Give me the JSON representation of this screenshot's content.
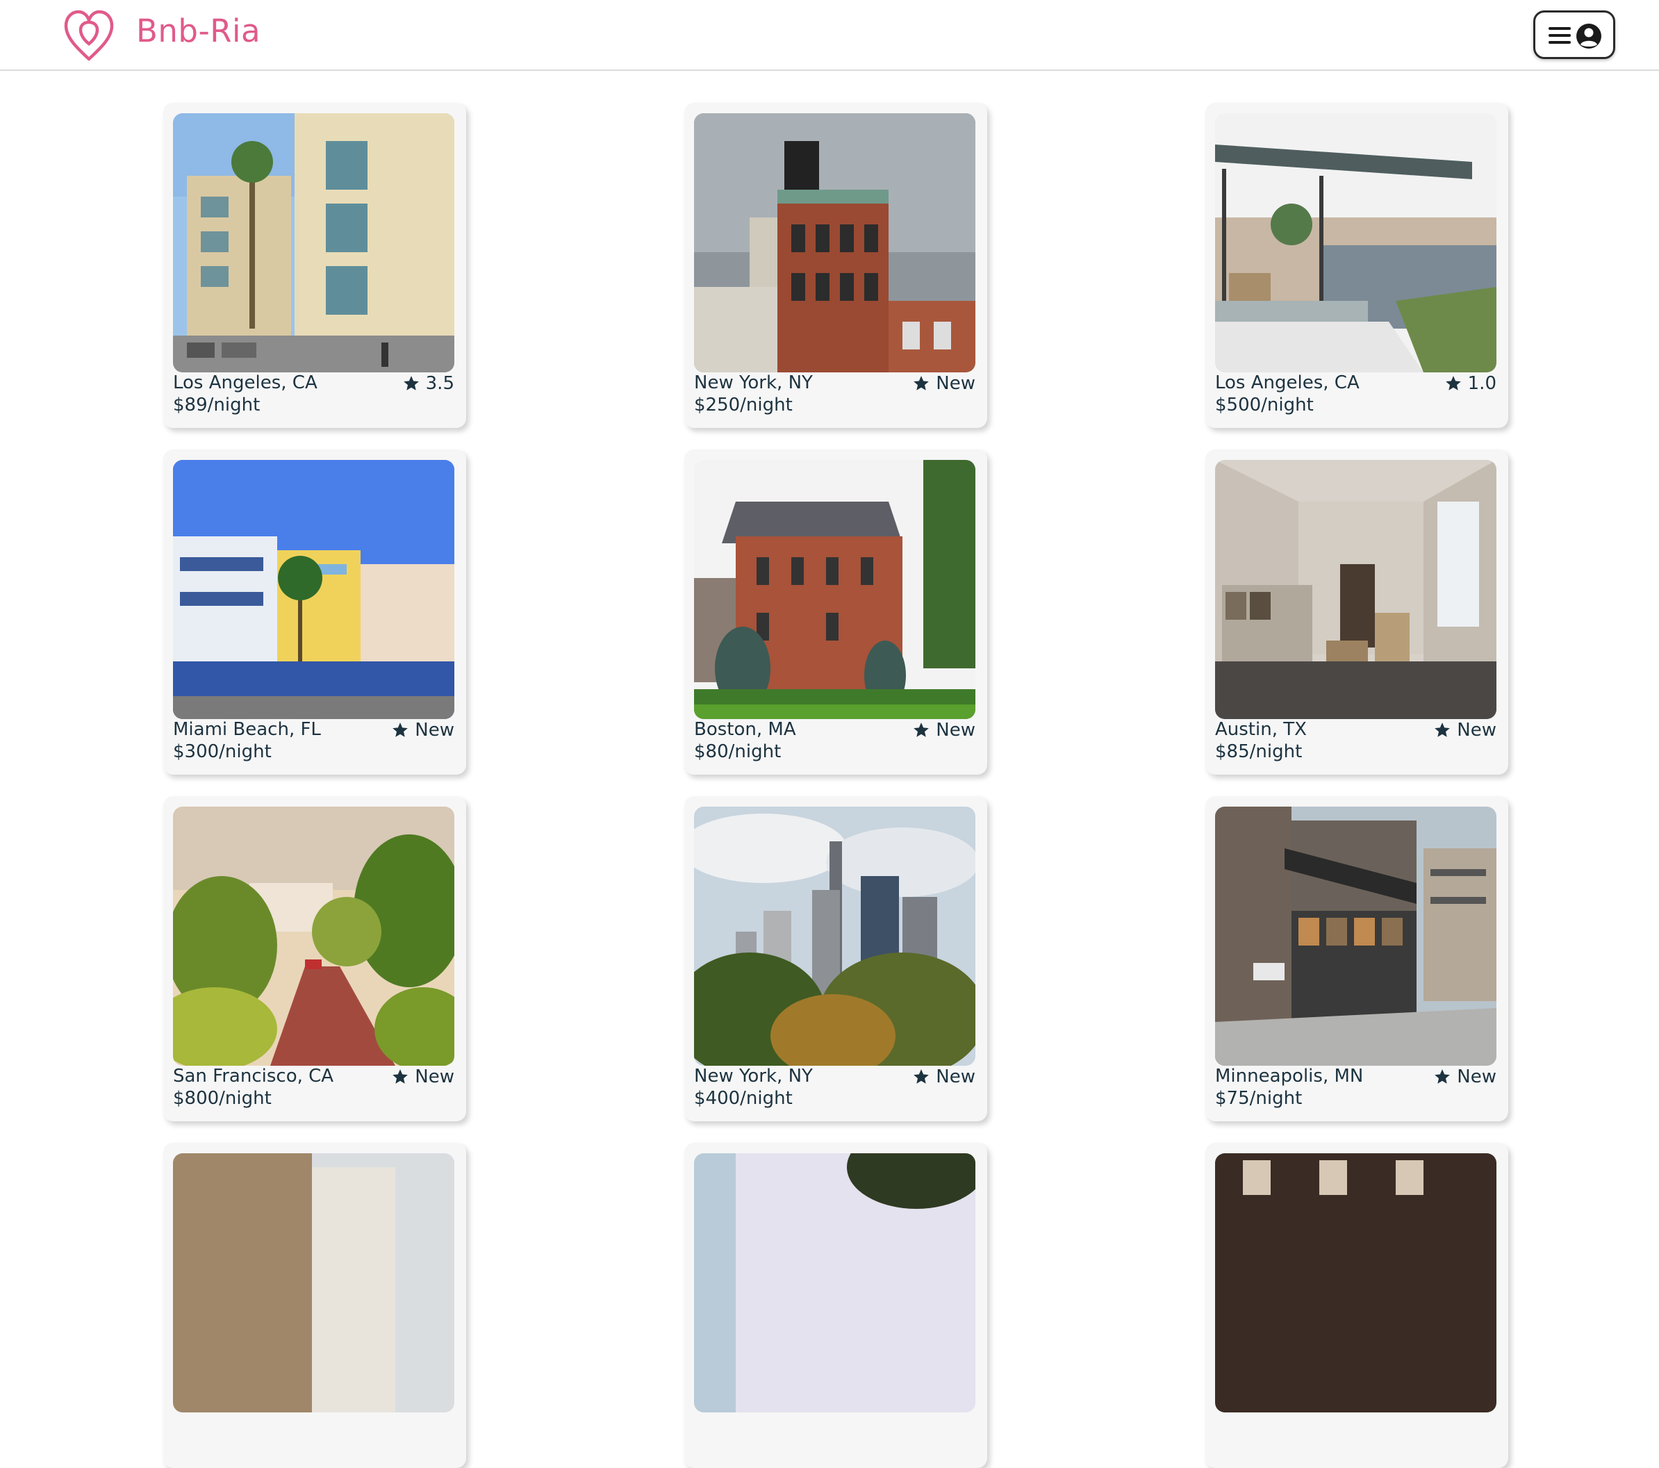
{
  "header": {
    "brand": "Bnb-Ria",
    "logo_icon": "airbnb-style-logo-icon",
    "menu_icon": "hamburger-icon",
    "user_icon": "user-circle-icon",
    "brand_color": "#e05a8a"
  },
  "listings": [
    {
      "location": "Los Angeles, CA",
      "price": "$89/night",
      "rating": "3.5",
      "photo": "apartment-building-with-palms"
    },
    {
      "location": "New York, NY",
      "price": "$250/night",
      "rating": "New",
      "photo": "brick-building-water-tower"
    },
    {
      "location": "Los Angeles, CA",
      "price": "$500/night",
      "rating": "1.0",
      "photo": "glass-house-city-view"
    },
    {
      "location": "Miami Beach, FL",
      "price": "$300/night",
      "rating": "New",
      "photo": "art-deco-hotels"
    },
    {
      "location": "Boston, MA",
      "price": "$80/night",
      "rating": "New",
      "photo": "red-brick-mansion"
    },
    {
      "location": "Austin, TX",
      "price": "$85/night",
      "rating": "New",
      "photo": "minimal-living-room"
    },
    {
      "location": "San Francisco, CA",
      "price": "$800/night",
      "rating": "New",
      "photo": "winding-street-gardens"
    },
    {
      "location": "New York, NY",
      "price": "$400/night",
      "rating": "New",
      "photo": "skyscrapers-over-park"
    },
    {
      "location": "Minneapolis, MN",
      "price": "$75/night",
      "rating": "New",
      "photo": "modern-brick-storefront"
    }
  ]
}
